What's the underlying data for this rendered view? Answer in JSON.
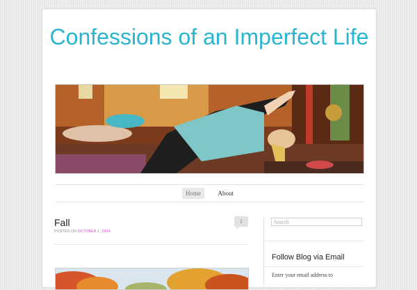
{
  "site": {
    "title": "Confessions of an Imperfect Life",
    "title_color": "#29b5cf"
  },
  "nav": {
    "items": [
      {
        "label": "Home",
        "active": true
      },
      {
        "label": "About",
        "active": false
      }
    ]
  },
  "post": {
    "title": "Fall",
    "meta_prefix": "POSTED ON",
    "date": "OCTOBER 1, 2014",
    "date_color": "#d63fc2",
    "comment_count": "1"
  },
  "sidebar": {
    "search_placeholder": "Search",
    "follow_widget_title": "Follow Blog via Email",
    "follow_widget_text": "Enter your email address to"
  }
}
